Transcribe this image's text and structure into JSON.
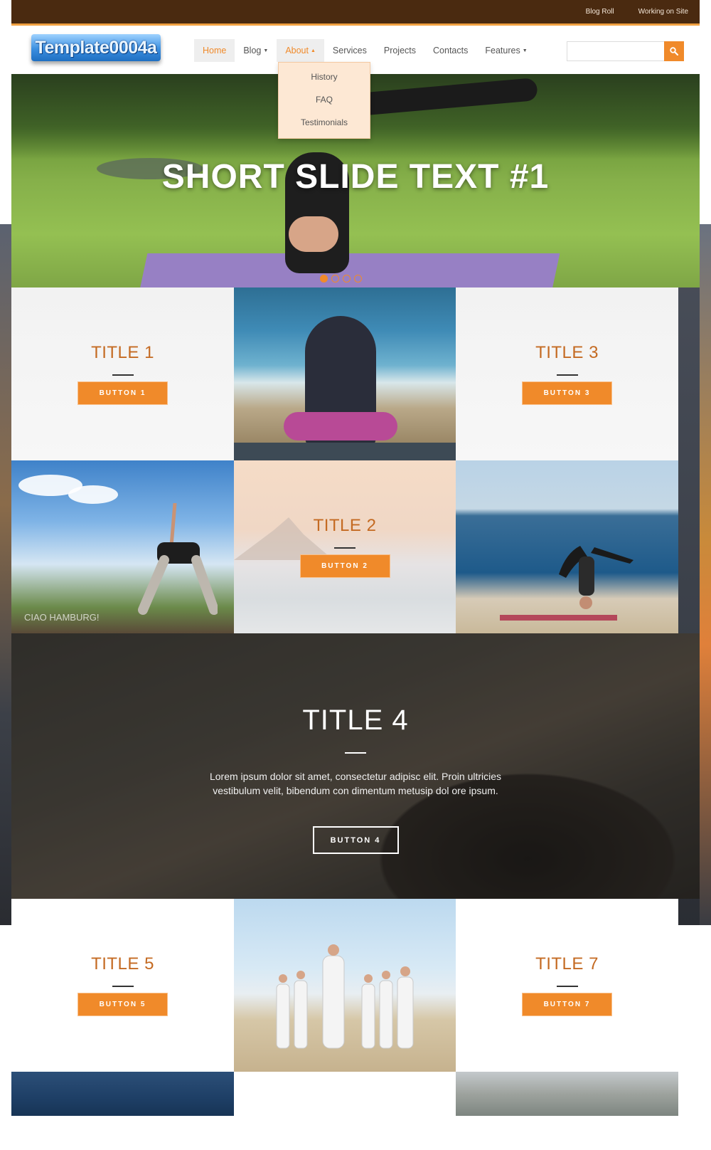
{
  "topbar": {
    "links": [
      "Blog Roll",
      "Working on Site"
    ]
  },
  "logo": {
    "text": "Template0004a"
  },
  "nav": {
    "items": [
      {
        "label": "Home",
        "state": "active"
      },
      {
        "label": "Blog",
        "has_dropdown": true
      },
      {
        "label": "About",
        "has_dropdown": true,
        "state": "open"
      },
      {
        "label": "Services"
      },
      {
        "label": "Projects"
      },
      {
        "label": "Contacts"
      },
      {
        "label": "Features",
        "has_dropdown": true
      }
    ],
    "about_dropdown": [
      "History",
      "FAQ",
      "Testimonials"
    ]
  },
  "search": {
    "value": "",
    "placeholder": "",
    "icon": "search-icon"
  },
  "slider": {
    "text": "SHORT SLIDE TEXT #1",
    "active_slide": 1,
    "slide_count": 4
  },
  "blocks": {
    "b1": {
      "title": "TITLE 1",
      "button": "BUTTON 1"
    },
    "b2": {
      "title": "TITLE 2",
      "button": "BUTTON 2"
    },
    "b3": {
      "title": "TITLE 3",
      "button": "BUTTON 3"
    },
    "b4": {
      "title": "TITLE 4",
      "text": "Lorem ipsum dolor sit amet, consectetur adipisc elit. Proin ultricies vestibulum velit, bibendum con dimentum metusip dol ore ipsum.",
      "button": "BUTTON 4"
    },
    "b5": {
      "title": "TITLE 5",
      "button": "BUTTON 5"
    },
    "b7": {
      "title": "TITLE 7",
      "button": "BUTTON 7"
    }
  },
  "photos": {
    "city_caption": "CIAO HAMBURG!"
  },
  "colors": {
    "accent": "#f08a2a",
    "title": "#c46a22",
    "topbar": "#4a2a10",
    "dropdown_bg": "#fde8d4"
  }
}
